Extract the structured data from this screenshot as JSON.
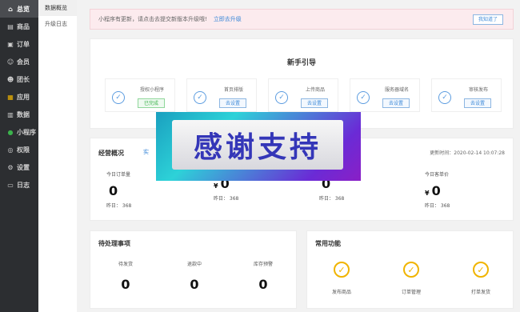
{
  "sidebar": {
    "items": [
      {
        "icon": "home-icon",
        "glyph": "⌂",
        "label": "总览",
        "active": true
      },
      {
        "icon": "goods-icon",
        "glyph": "▤",
        "label": "商品",
        "active": false
      },
      {
        "icon": "order-icon",
        "glyph": "▣",
        "label": "订单",
        "active": false
      },
      {
        "icon": "member-icon",
        "glyph": "☺",
        "label": "会员",
        "active": false
      },
      {
        "icon": "team-icon",
        "glyph": "☻",
        "label": "团长",
        "active": false
      },
      {
        "icon": "apps-icon",
        "glyph": "▦",
        "label": "应用",
        "active": false
      },
      {
        "icon": "data-icon",
        "glyph": "▥",
        "label": "数据",
        "active": false
      },
      {
        "icon": "miniprogram-icon",
        "glyph": "●",
        "label": "小程序",
        "active": false
      },
      {
        "icon": "permission-icon",
        "glyph": "◎",
        "label": "权限",
        "active": false
      },
      {
        "icon": "settings-icon",
        "glyph": "⚙",
        "label": "设置",
        "active": false
      },
      {
        "icon": "log-icon",
        "glyph": "▭",
        "label": "日志",
        "active": false
      }
    ]
  },
  "subnav": {
    "items": [
      {
        "label": "数据概览",
        "active": true
      },
      {
        "label": "升级日志",
        "active": false
      }
    ]
  },
  "notice": {
    "text": "小程序有更新，请点击去提交新版本升级哦!",
    "link": "立即去升级",
    "button": "我知道了"
  },
  "guide": {
    "title": "新手引导",
    "steps": [
      {
        "name": "授权小程序",
        "button": "已完成",
        "done": true
      },
      {
        "name": "首页排版",
        "button": "去设置",
        "done": false
      },
      {
        "name": "上传商品",
        "button": "去设置",
        "done": false
      },
      {
        "name": "服务器域名",
        "button": "去设置",
        "done": false
      },
      {
        "name": "审核发布",
        "button": "去设置",
        "done": false
      }
    ]
  },
  "overview": {
    "title": "经营概况",
    "tab": "实",
    "update_time": "更新时间：2020-02-14 10:07:28",
    "stats": [
      {
        "label": "今日订单量",
        "currency": "",
        "value": "0",
        "prev": "昨日：  368"
      },
      {
        "label": "",
        "currency": "¥",
        "value": "0",
        "prev": "昨日：  368"
      },
      {
        "label": "",
        "currency": "",
        "value": "0",
        "prev": "昨日：  368"
      },
      {
        "label": "今日客单价",
        "currency": "¥",
        "value": "0",
        "prev": "昨日：  368"
      }
    ]
  },
  "pending": {
    "title": "待处理事项",
    "items": [
      {
        "label": "待发货",
        "value": "0"
      },
      {
        "label": "退款中",
        "value": "0"
      },
      {
        "label": "库存预警",
        "value": "0"
      }
    ]
  },
  "common": {
    "title": "常用功能",
    "items": [
      {
        "label": "发布商品",
        "icon": "check-circle-icon"
      },
      {
        "label": "订单管理",
        "icon": "check-circle-icon"
      },
      {
        "label": "打单发货",
        "icon": "check-circle-icon"
      }
    ]
  },
  "banner": {
    "text": "感谢支持"
  },
  "colors": {
    "sidebar_bg": "#2c2e31",
    "accent_blue": "#3b88d8",
    "accent_orange": "#f0b400",
    "done_green": "#3bb24c"
  }
}
